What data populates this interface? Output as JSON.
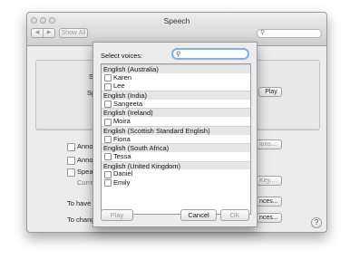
{
  "window": {
    "title": "Speech",
    "show_all_label": "Show All",
    "nav_back_icon": "chevron-left-icon",
    "nav_forward_icon": "chevron-right-icon",
    "search_icon": "search-icon"
  },
  "background": {
    "s_label": "S",
    "sp_label": "Sp",
    "play_label": "Play",
    "annou_1": "Annou",
    "annou_2": "Annou",
    "speak": "Speak",
    "current": "Curren",
    "options_btn": "ions...",
    "key_btn": "Key...",
    "to_have": "To have",
    "to_chang": "To chang",
    "ences_1": "nces...",
    "ences_2": "nces...",
    "help_label": "?"
  },
  "sheet": {
    "select_label": "Select voices:",
    "search_icon": "search-icon",
    "search_value": "",
    "groups": [
      {
        "header": "English (Australia)",
        "voices": [
          "Karen",
          "Lee"
        ]
      },
      {
        "header": "English (India)",
        "voices": [
          "Sangeeta"
        ]
      },
      {
        "header": "English (Ireland)",
        "voices": [
          "Moira"
        ]
      },
      {
        "header": "English (Scottish Standard English)",
        "voices": [
          "Fiona"
        ]
      },
      {
        "header": "English (South Africa)",
        "voices": [
          "Tessa"
        ]
      },
      {
        "header": "English (United Kingdom)",
        "voices": [
          "Daniel",
          "Emily"
        ]
      }
    ],
    "play_label": "Play",
    "cancel_label": "Cancel",
    "ok_label": "OK"
  }
}
